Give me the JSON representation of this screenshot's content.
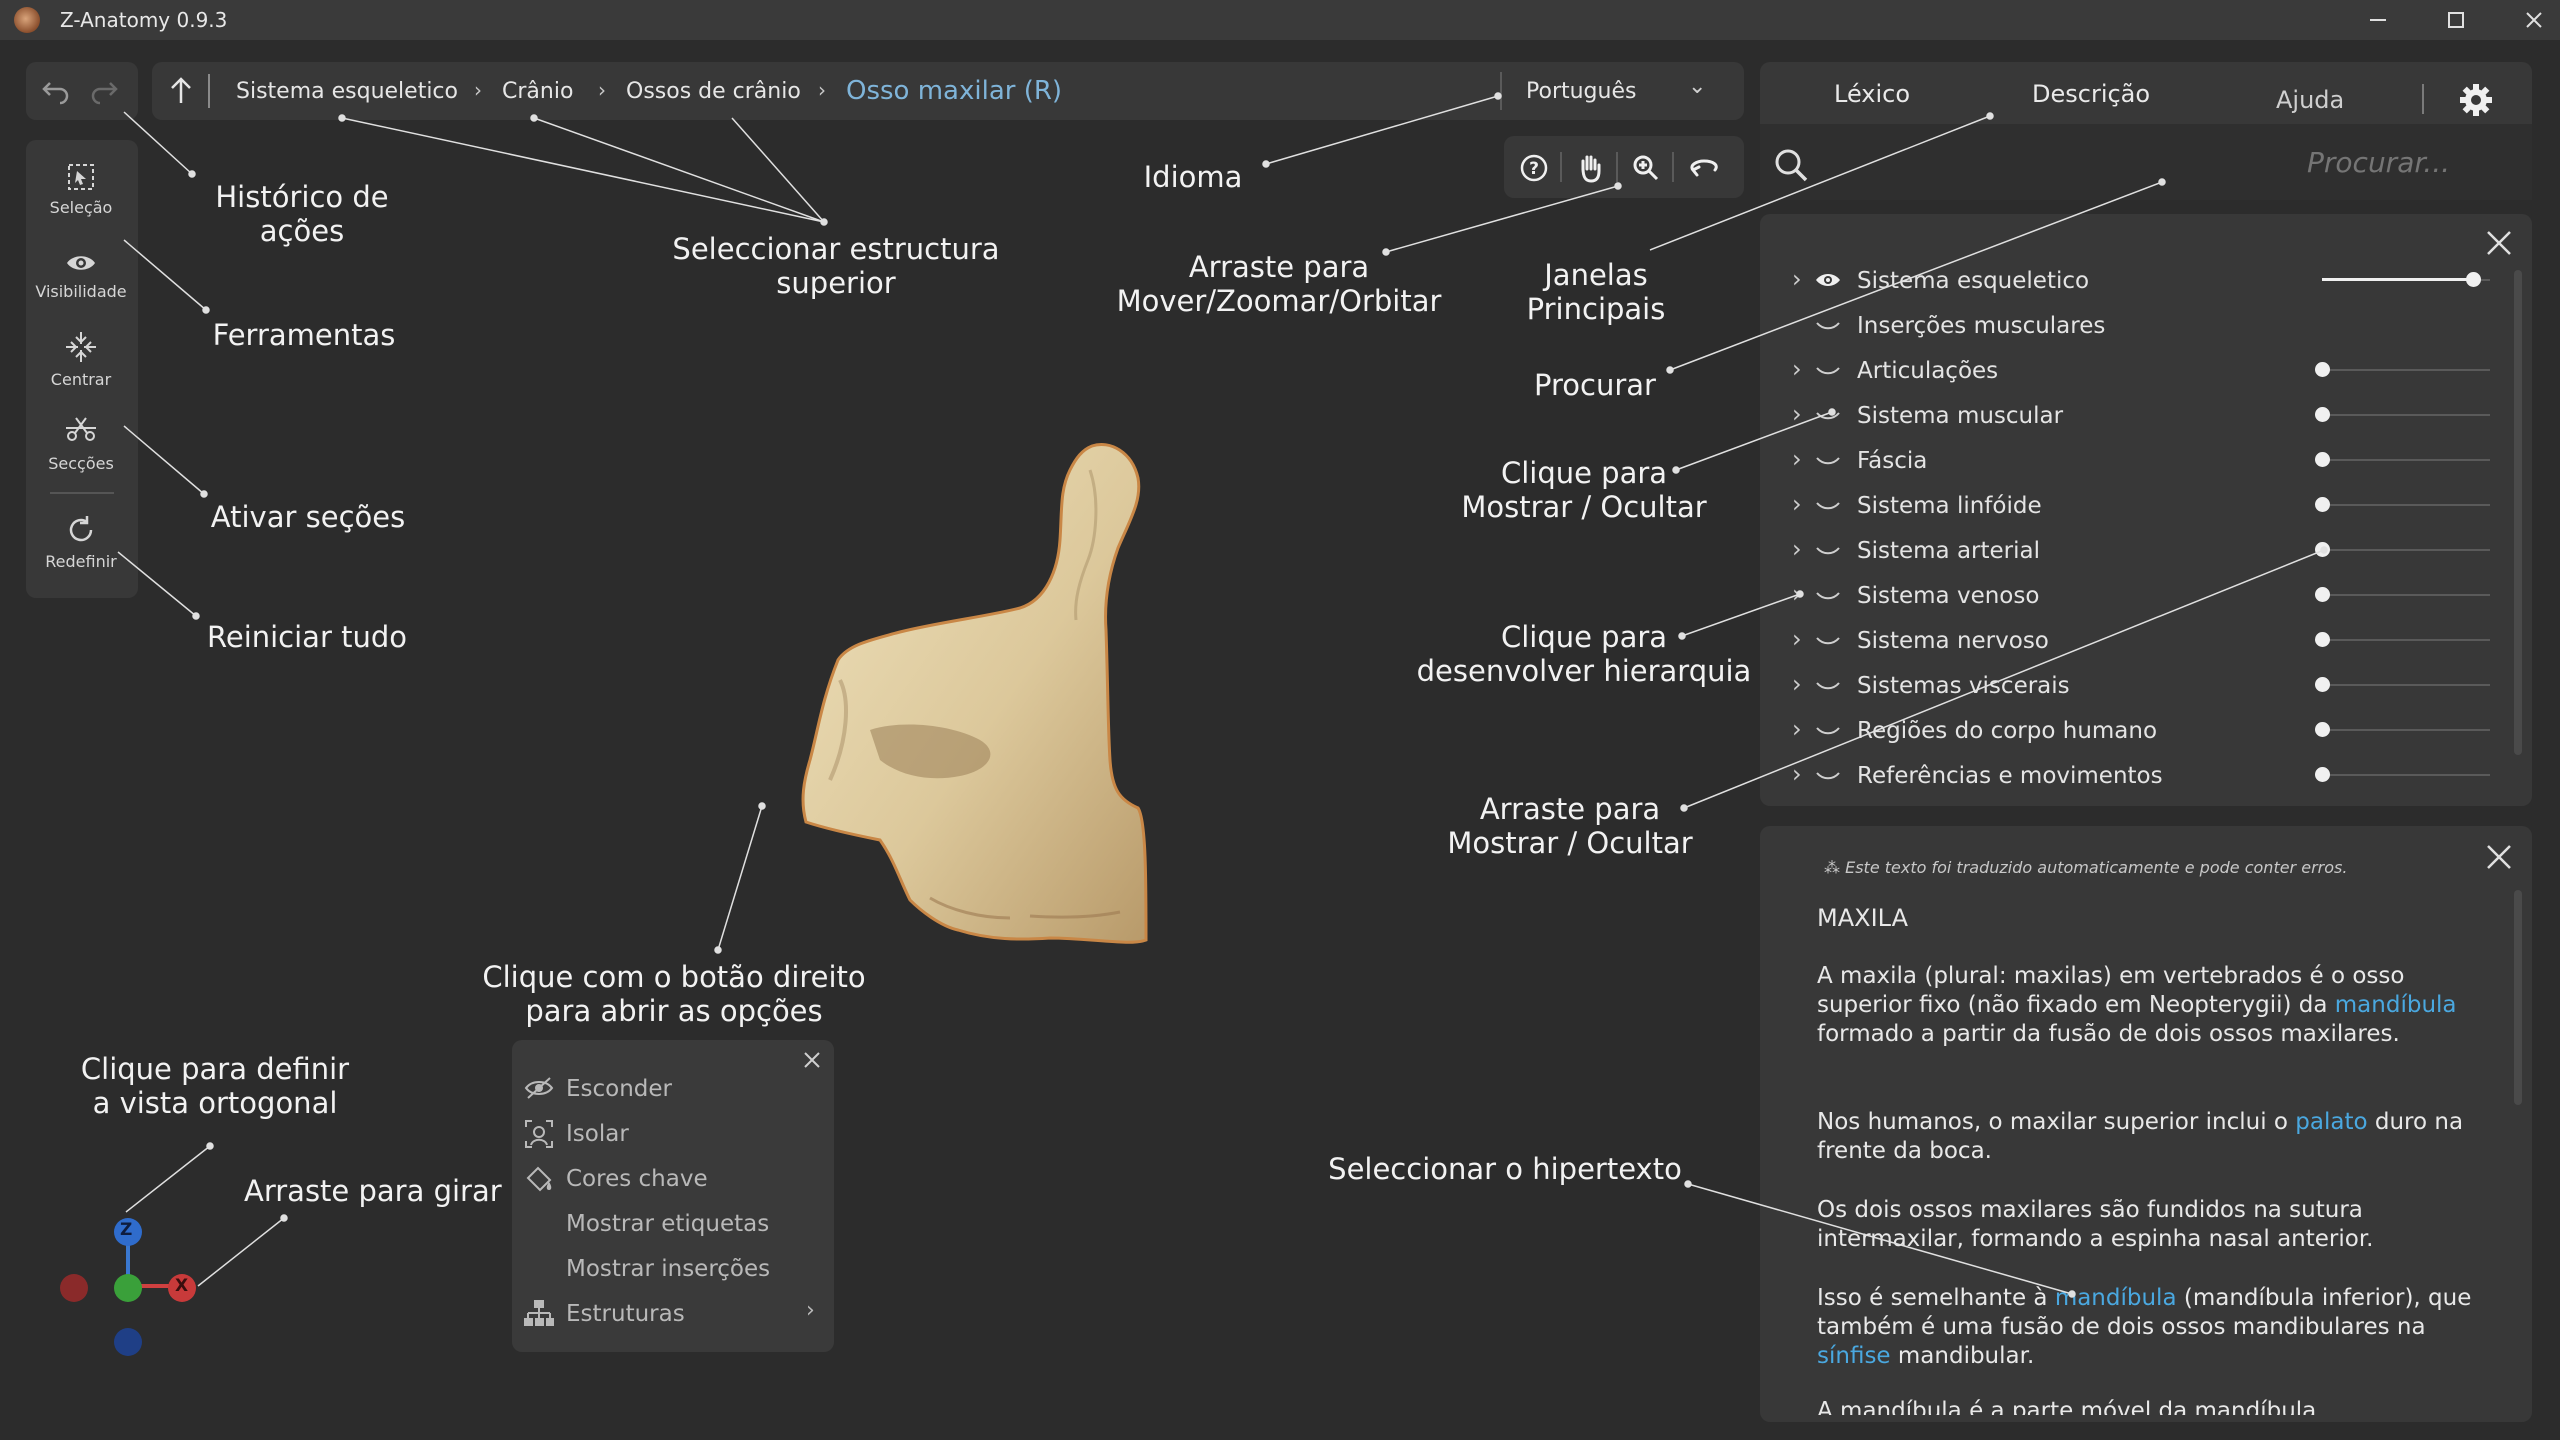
{
  "window": {
    "title": "Z-Anatomy 0.9.3"
  },
  "breadcrumb": {
    "items": [
      "Sistema esqueletico",
      "Crânio",
      "Ossos de crânio"
    ],
    "current": "Osso maxilar (R)"
  },
  "language": {
    "selected": "Português"
  },
  "tabs": [
    "Léxico",
    "Descrição",
    "Ajuda"
  ],
  "search": {
    "placeholder": "Procurar..."
  },
  "tools": [
    {
      "label": "Seleção",
      "icon": "selection-icon"
    },
    {
      "label": "Visibilidade",
      "icon": "eye-icon"
    },
    {
      "label": "Centrar",
      "icon": "center-icon"
    },
    {
      "label": "Secções",
      "icon": "scissors-icon"
    },
    {
      "label": "Redefinir",
      "icon": "reset-icon"
    }
  ],
  "layers": [
    {
      "label": "Sistema esqueletico",
      "visible": true,
      "level": 0.9
    },
    {
      "label": "Inserções musculares",
      "visible": false
    },
    {
      "label": "Articulações",
      "visible": false,
      "level": 0.0
    },
    {
      "label": "Sistema muscular",
      "visible": false,
      "level": 0.0
    },
    {
      "label": "Fáscia",
      "visible": false,
      "level": 0.0
    },
    {
      "label": "Sistema linfóide",
      "visible": false,
      "level": 0.0
    },
    {
      "label": "Sistema arterial",
      "visible": false,
      "level": 0.0
    },
    {
      "label": "Sistema venoso",
      "visible": false,
      "level": 0.0
    },
    {
      "label": "Sistema nervoso",
      "visible": false,
      "level": 0.0
    },
    {
      "label": "Sistemas viscerais",
      "visible": false,
      "level": 0.0
    },
    {
      "label": "Regiões do corpo humano",
      "visible": false,
      "level": 0.0
    },
    {
      "label": "Referências e movimentos",
      "visible": false,
      "level": 0.0
    }
  ],
  "context_menu": {
    "items": [
      "Esconder",
      "Isolar",
      "Cores chave",
      "Mostrar etiquetas",
      "Mostrar inserções",
      "Estruturas"
    ]
  },
  "description": {
    "notice": "Este texto foi traduzido automaticamente e pode conter erros.",
    "title": "MAXILA",
    "p1_a": "A maxila (plural: maxilas) em vertebrados é o osso superior fixo (não fixado em Neopterygii) da ",
    "p1_link": "mandíbula",
    "p1_b": " formado a partir da fusão de dois ossos maxilares.",
    "p2_a": "Nos humanos, o maxilar superior inclui o ",
    "p2_link": "palato",
    "p2_b": " duro na frente da boca.",
    "p3": "Os dois ossos maxilares são fundidos na sutura intermaxilar, formando a espinha nasal anterior.",
    "p4_a": "Isso é semelhante à ",
    "p4_link1": "mandíbula",
    "p4_b": " (mandíbula inferior), que também é uma fusão de dois ossos mandibulares na ",
    "p4_link2": "sínfise",
    "p4_c": " mandibular.",
    "p5": "A mandíbula é a parte móvel da mandíbula"
  },
  "gizmo": {
    "z": "Z",
    "x": "X"
  },
  "annotations": {
    "historico": "Histórico de\nações",
    "ferramentas": "Ferramentas",
    "ativar": "Ativar seções",
    "reiniciar": "Reiniciar tudo",
    "seleccionar_superior": "Seleccionar estructura\nsuperior",
    "idioma": "Idioma",
    "arraste_mover": "Arraste para\nMover/Zoomar/Orbitar",
    "janelas": "Janelas\nPrincipais",
    "procurar": "Procurar",
    "clique_mostrar": "Clique para\nMostrar / Ocultar",
    "clique_hierarquia": "Clique para\ndesenvolver hierarquia",
    "arraste_mostrar": "Arraste para\nMostrar / Ocultar",
    "clique_direito": "Clique com o botão direito\npara abrir as opções",
    "vista_ortogonal": "Clique para definir\na vista ortogonal",
    "arraste_girar": "Arraste para girar",
    "hipertexto": "Seleccionar o hipertexto"
  },
  "colors": {
    "background": "#2c2c2c",
    "panel": "#383838",
    "accent_link": "#4aa8e0",
    "current_crumb": "#7fb4d9",
    "bone": "#e3d2a8"
  }
}
